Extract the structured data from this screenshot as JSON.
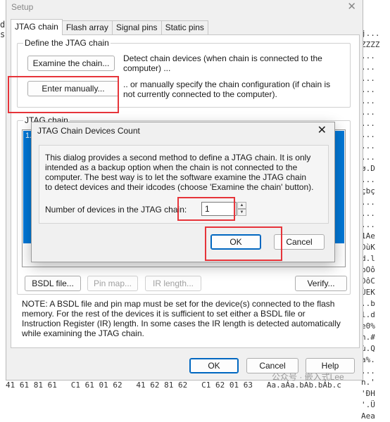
{
  "setup_window": {
    "title": "Setup",
    "close_glyph": "✕",
    "tabs": [
      {
        "label": "JTAG chain",
        "active": true
      },
      {
        "label": "Flash array",
        "active": false
      },
      {
        "label": "Signal pins",
        "active": false
      },
      {
        "label": "Static pins",
        "active": false
      }
    ],
    "define_group_label": "Define the JTAG chain",
    "examine_button": "Examine the chain...",
    "examine_desc_1": "Detect chain devices (when chain is connected to the",
    "examine_desc_2": "computer) ...",
    "manual_button": "Enter manually...",
    "manual_desc_1": ".. or manually specify the chain configuration (if chain is",
    "manual_desc_2": "not currently connected to the computer).",
    "chain_group_label": "JTAG chain",
    "chain_list_item": "1.",
    "bsdl_button": "BSDL file...",
    "pinmap_button": "Pin map...",
    "irlength_button": "IR length...",
    "verify_button": "Verify...",
    "note_lines": [
      "NOTE: A BSDL file and pin map must be set for the device(s) connected to the flash",
      "memory. For the rest of the devices it is sufficient to set either a BSDL file or",
      "Instruction Register (IR) length. In some cases the IR length is detected automatically",
      "while examining the JTAG chain."
    ],
    "ok_button": "OK",
    "cancel_button": "Cancel",
    "help_button": "Help"
  },
  "dialog": {
    "title": "JTAG Chain Devices Count",
    "close_glyph": "✕",
    "text_lines": [
      "This dialog provides a second method to define a JTAG chain. It is only",
      "intended as a backup option when the chain is not connected to the",
      "computer. The best way is to let the software examine the JTAG chain",
      "to detect devices and their idcodes (choose 'Examine the chain' button)."
    ],
    "count_label": "Number of devices in the JTAG chain:",
    "count_value": "1",
    "ok_button": "OK",
    "cancel_button": "Cancel"
  },
  "background_hex": {
    "right_column": [
      "j...",
      "ZZZZ",
      "...",
      "...",
      "...",
      "...",
      "...",
      "...",
      "...",
      "...",
      "...",
      "...",
      "ø.D",
      "...",
      "çbç",
      "...",
      "...",
      "...",
      "1Ae",
      "DùK",
      "d.l",
      "bOô",
      "DôC",
      "ÙEK",
      "..b",
      "l.d",
      "e0%",
      "h.#",
      "ù.Q",
      "a%.",
      "...",
      "h.'",
      "'ÐH",
      "'.Ü",
      "Aea"
    ],
    "left_column": [
      "d",
      "s"
    ],
    "bottom_row": "41 61 81 61   C1 61 01 62   41 62 81 62   C1 62 01 63   Aa.aÁa.bAb.bÁb.c"
  },
  "watermark": "公众号 · 嵌入式Lee",
  "colors": {
    "selection": "#0078d7",
    "highlight": "#e6343a",
    "primary_border": "#0067c0"
  }
}
